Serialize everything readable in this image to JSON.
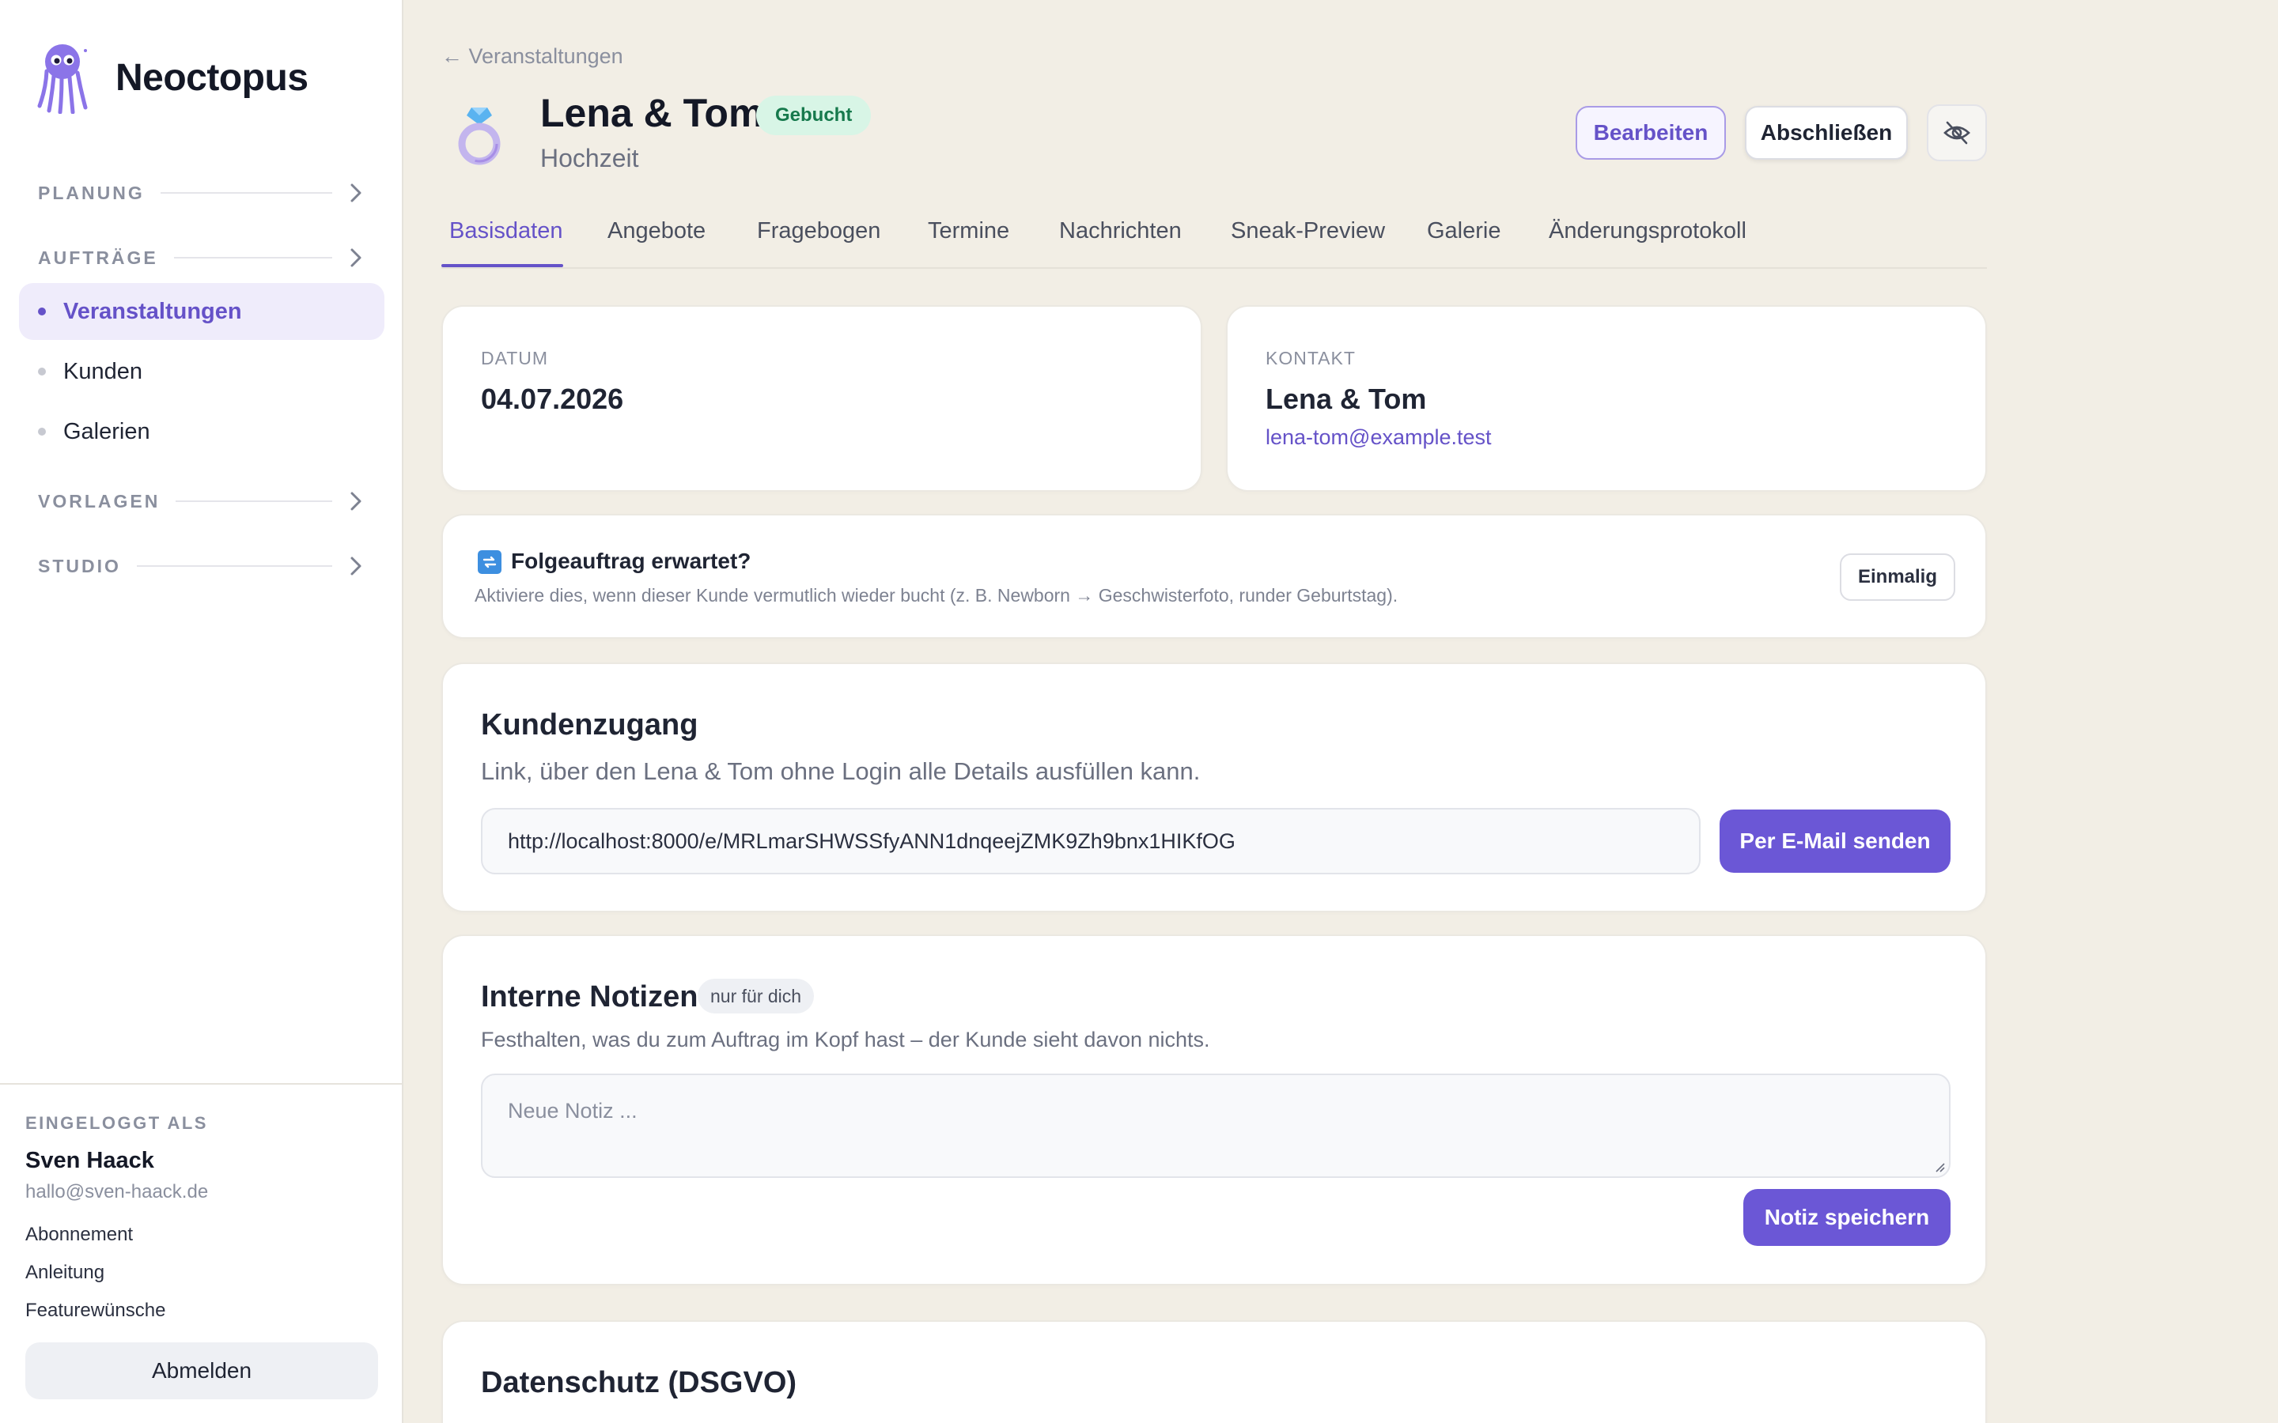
{
  "app": {
    "name": "Neoctopus"
  },
  "sidebar": {
    "sections": [
      {
        "label": "PLANUNG"
      },
      {
        "label": "AUFTRÄGE"
      },
      {
        "label": "VORLAGEN"
      },
      {
        "label": "STUDIO"
      }
    ],
    "items": [
      {
        "label": "Veranstaltungen",
        "active": true
      },
      {
        "label": "Kunden"
      },
      {
        "label": "Galerien"
      }
    ],
    "footer": {
      "logged_in_label": "EINGELOGGT ALS",
      "user_name": "Sven Haack",
      "user_email": "hallo@sven-haack.de",
      "links": [
        "Abonnement",
        "Anleitung",
        "Featurewünsche"
      ],
      "logout_label": "Abmelden"
    }
  },
  "header": {
    "back_link": "← Veranstaltungen",
    "title": "Lena & Tom",
    "status_badge": "Gebucht",
    "subtitle": "Hochzeit",
    "edit_label": "Bearbeiten",
    "close_label": "Abschließen",
    "icon": "ring-icon"
  },
  "tabs": [
    {
      "label": "Basisdaten",
      "active": true
    },
    {
      "label": "Angebote"
    },
    {
      "label": "Fragebogen"
    },
    {
      "label": "Termine"
    },
    {
      "label": "Nachrichten"
    },
    {
      "label": "Sneak-Preview"
    },
    {
      "label": "Galerie"
    },
    {
      "label": "Änderungsprotokoll"
    }
  ],
  "date_card": {
    "label": "DATUM",
    "value": "04.07.2026"
  },
  "contact_card": {
    "label": "KONTAKT",
    "name": "Lena & Tom",
    "email": "lena-tom@example.test"
  },
  "follow_up": {
    "title": "Folgeauftrag erwartet?",
    "description": "Aktiviere dies, wenn dieser Kunde vermutlich wieder bucht (z. B. Newborn → Geschwisterfoto, runder Geburtstag).",
    "button_label": "Einmalig"
  },
  "customer_access": {
    "title": "Kundenzugang",
    "description": "Link, über den Lena & Tom ohne Login alle Details ausfüllen kann.",
    "url": "http://localhost:8000/e/MRLmarSHWSSfyANN1dnqeejZMK9Zh9bnx1HIKfOG",
    "send_label": "Per E-Mail senden"
  },
  "notes": {
    "title": "Interne Notizen",
    "badge": "nur für dich",
    "description": "Festhalten, was du zum Auftrag im Kopf hast – der Kunde sieht davon nichts.",
    "placeholder": "Neue Notiz ...",
    "save_label": "Notiz speichern"
  },
  "privacy": {
    "title": "Datenschutz (DSGVO)"
  },
  "colors": {
    "accent": "#6552c8",
    "primary_button": "#6b57d6",
    "background": "#f2eee5",
    "badge_booked_bg": "#d8f5e6",
    "badge_booked_text": "#16794c"
  }
}
